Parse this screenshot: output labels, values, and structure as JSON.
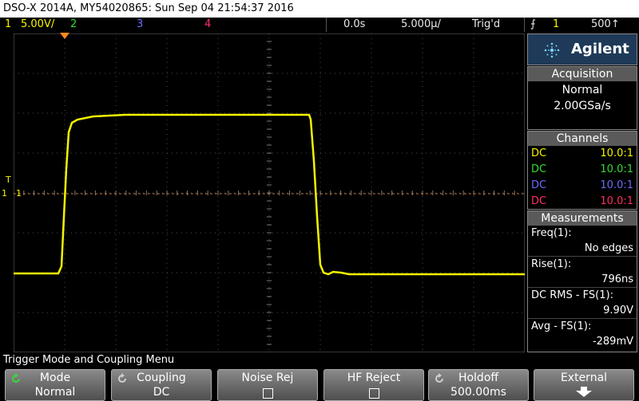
{
  "title_bar": "DSO-X 2014A, MY54020865: Sun Sep 04 21:54:37 2016",
  "status": {
    "ch1_num": "1",
    "ch1_scale": "5.00V/",
    "ch2_num": "2",
    "ch3_num": "3",
    "ch4_num": "4",
    "time_delay": "0.0s",
    "time_scale": "5.000µ/",
    "trig_state": "Trig'd",
    "trig_source": "1",
    "trig_level": "500↑"
  },
  "left_markers": {
    "trigger_level": "T",
    "ch1_ground": "1",
    "ch1_ref": "1"
  },
  "brand": "Agilent",
  "acquisition": {
    "header": "Acquisition",
    "mode": "Normal",
    "rate": "2.00GSa/s"
  },
  "channels": {
    "header": "Channels",
    "rows": [
      {
        "coupling": "DC",
        "probe": "10.0:1",
        "color": "#f4f400"
      },
      {
        "coupling": "DC",
        "probe": "10.0:1",
        "color": "#33dd33"
      },
      {
        "coupling": "DC",
        "probe": "10.0:1",
        "color": "#6b6bff"
      },
      {
        "coupling": "DC",
        "probe": "10.0:1",
        "color": "#ff3060"
      }
    ]
  },
  "measurements": {
    "header": "Measurements",
    "items": [
      {
        "label": "Freq(1):",
        "value": "No edges"
      },
      {
        "label": "Rise(1):",
        "value": "796ns"
      },
      {
        "label": "DC RMS - FS(1):",
        "value": "9.90V"
      },
      {
        "label": "Avg - FS(1):",
        "value": "-289mV"
      }
    ]
  },
  "menu_title": "Trigger Mode and Coupling Menu",
  "softkeys": [
    {
      "title": "Mode",
      "value": "Normal"
    },
    {
      "title": "Coupling",
      "value": "DC"
    },
    {
      "title": "Noise Rej",
      "value": ""
    },
    {
      "title": "HF Reject",
      "value": ""
    },
    {
      "title": "Holdoff",
      "value": "500.00ms"
    },
    {
      "title": "External",
      "value": ""
    }
  ],
  "colors": {
    "ch1": "#f4f400",
    "ch2": "#33dd33",
    "ch3": "#6b6bff",
    "ch4": "#ff3060",
    "trigger_marker": "#ff8c1a",
    "brand_panel": "#1e3a58"
  }
}
